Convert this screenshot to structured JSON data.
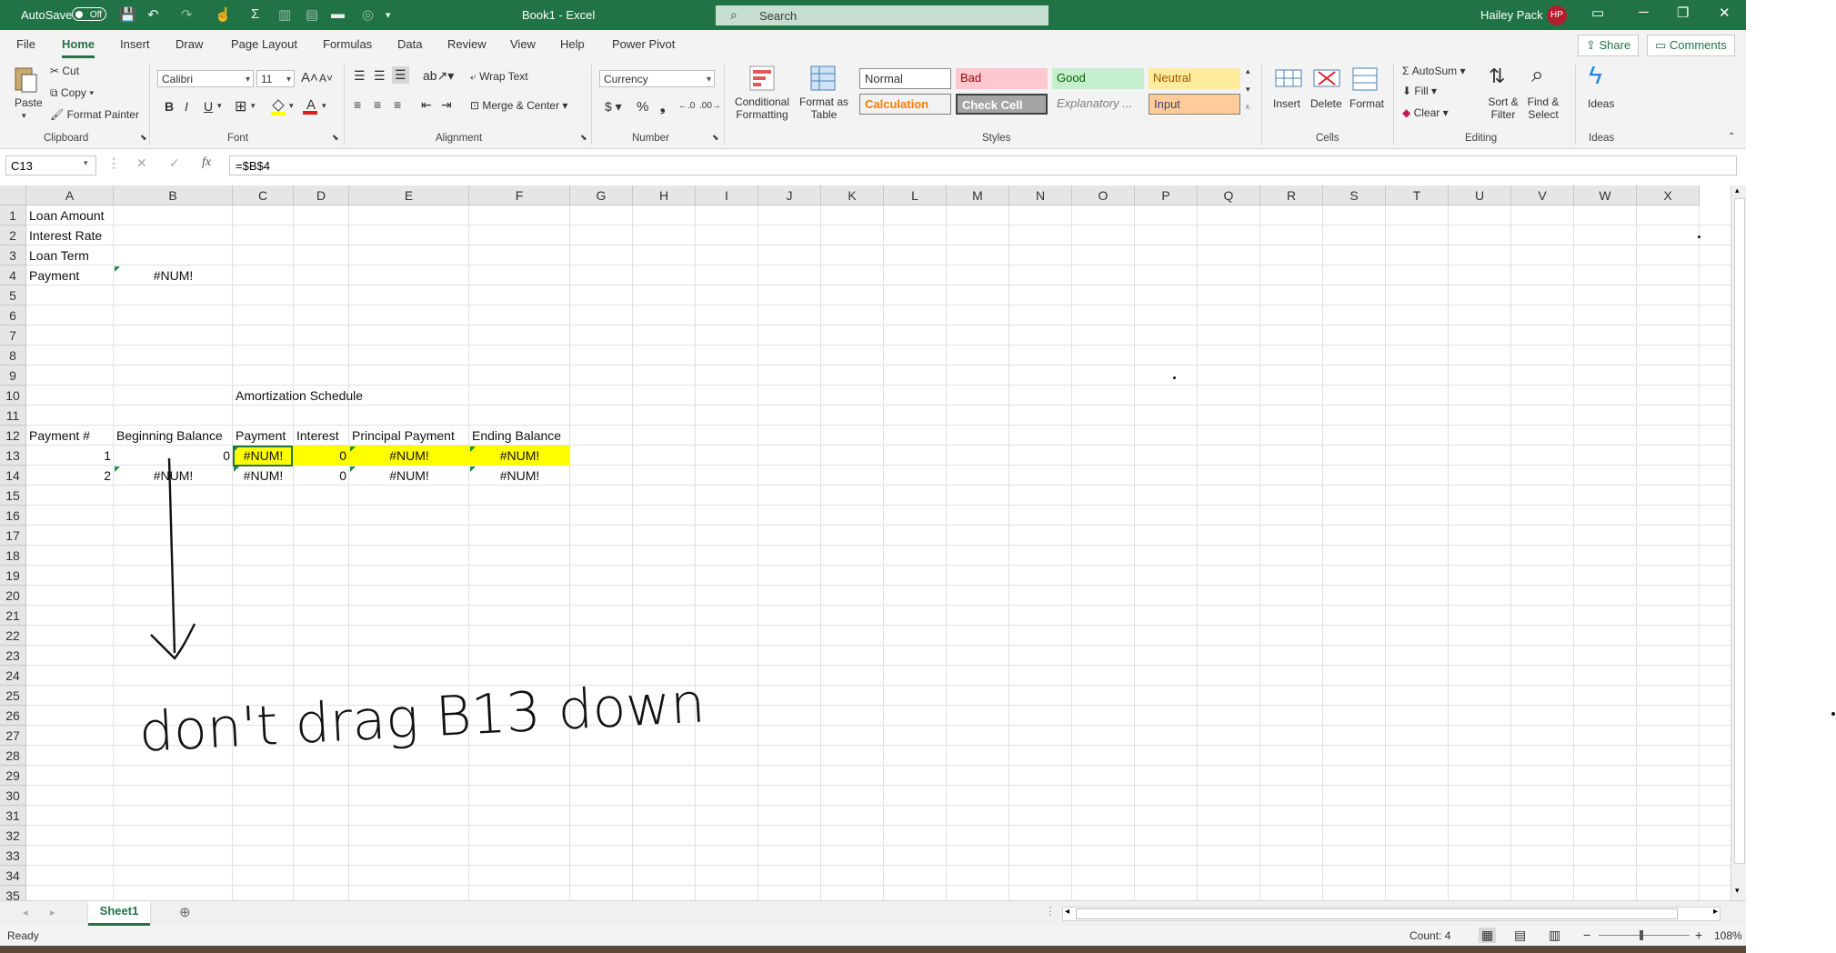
{
  "titlebar": {
    "autosave_label": "AutoSave",
    "autosave_state": "Off",
    "doc_title": "Book1 - Excel",
    "search_placeholder": "Search",
    "user_name": "Hailey Pack",
    "user_initials": "HP"
  },
  "tabs": [
    "File",
    "Home",
    "Insert",
    "Draw",
    "Page Layout",
    "Formulas",
    "Data",
    "Review",
    "View",
    "Help",
    "Power Pivot"
  ],
  "active_tab": "Home",
  "share_label": "Share",
  "comments_label": "Comments",
  "ribbon": {
    "clipboard": {
      "paste": "Paste",
      "cut": "Cut",
      "copy": "Copy",
      "format_painter": "Format Painter",
      "group": "Clipboard"
    },
    "font": {
      "name": "Calibri",
      "size": "11",
      "bold": "B",
      "italic": "I",
      "underline": "U",
      "group": "Font"
    },
    "alignment": {
      "wrap": "Wrap Text",
      "merge": "Merge & Center",
      "group": "Alignment"
    },
    "number": {
      "format": "Currency",
      "group": "Number"
    },
    "styles": {
      "conditional": "Conditional Formatting",
      "format_table": "Format as Table",
      "normal": "Normal",
      "bad": "Bad",
      "good": "Good",
      "neutral": "Neutral",
      "calculation": "Calculation",
      "check_cell": "Check Cell",
      "explanatory": "Explanatory ...",
      "input": "Input",
      "group": "Styles"
    },
    "cells": {
      "insert": "Insert",
      "delete": "Delete",
      "format": "Format",
      "group": "Cells"
    },
    "editing": {
      "autosum": "AutoSum",
      "fill": "Fill",
      "clear": "Clear",
      "sort": "Sort & Filter",
      "find": "Find & Select",
      "group": "Editing"
    },
    "ideas": {
      "ideas": "Ideas",
      "group": "Ideas"
    }
  },
  "formula_bar": {
    "name_box": "C13",
    "formula": "=$B$4"
  },
  "grid": {
    "columns": [
      "A",
      "B",
      "C",
      "D",
      "E",
      "F",
      "G",
      "H",
      "I",
      "J",
      "K",
      "L",
      "M",
      "N",
      "O",
      "P",
      "Q",
      "R",
      "S",
      "T",
      "U",
      "V",
      "W",
      "X"
    ],
    "rows": [
      "1",
      "2",
      "3",
      "4",
      "5",
      "6",
      "7",
      "8",
      "9",
      "10",
      "11",
      "12",
      "13",
      "14",
      "15",
      "16",
      "17",
      "18",
      "19",
      "20",
      "21",
      "22",
      "23",
      "24",
      "25",
      "26",
      "27",
      "28",
      "29",
      "30",
      "31",
      "32",
      "33",
      "34",
      "35"
    ],
    "cells": {
      "A1": "Loan Amount",
      "A2": "Interest Rate",
      "A3": "Loan Term",
      "A4": "Payment",
      "B4": "#NUM!",
      "C10": "Amortization Schedule",
      "A12": "Payment #",
      "B12": "Beginning Balance",
      "C12": "Payment",
      "D12": "Interest",
      "E12": "Principal Payment",
      "F12": "Ending Balance",
      "A13": "1",
      "B13": "0",
      "C13": "#NUM!",
      "D13": "0",
      "E13": "#NUM!",
      "F13": "#NUM!",
      "A14": "2",
      "B14": "#NUM!",
      "C14": "#NUM!",
      "D14": "0",
      "E14": "#NUM!",
      "F14": "#NUM!"
    },
    "annotation": "don't drag B13 down"
  },
  "sheet_tab": "Sheet1",
  "status": {
    "ready": "Ready",
    "count": "Count: 4",
    "zoom": "108%"
  },
  "colors": {
    "excel_green": "#217346",
    "highlight": "#ffff00"
  }
}
